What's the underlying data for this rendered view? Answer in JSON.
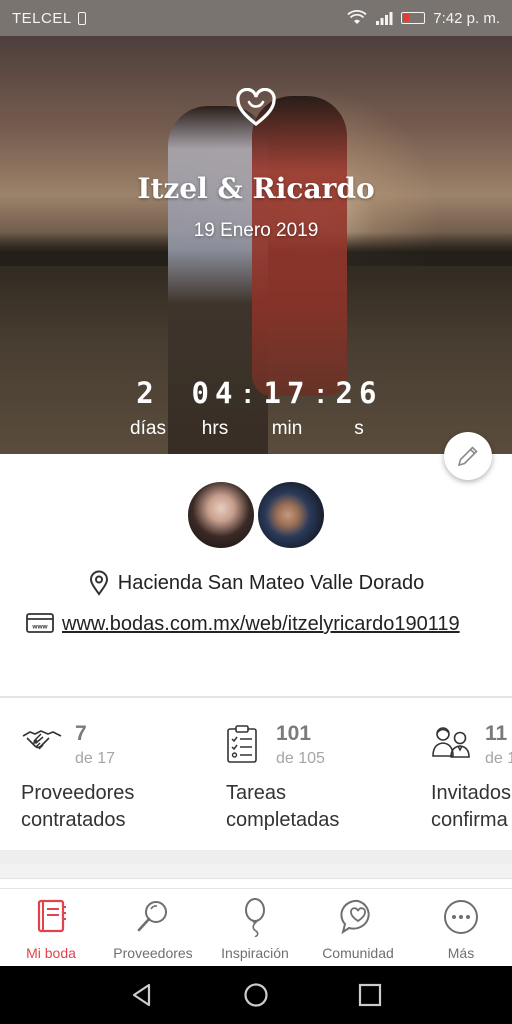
{
  "status_bar": {
    "carrier": "TELCEL",
    "time": "7:42 p. m."
  },
  "hero": {
    "couple_names": "Itzel & Ricardo",
    "date": "19 Enero 2019",
    "countdown": {
      "days": "2",
      "hours": "04",
      "minutes": "17",
      "seconds": "26",
      "days_label": "días",
      "hours_label": "hrs",
      "minutes_label": "min",
      "seconds_label": "s"
    }
  },
  "info": {
    "location": "Hacienda San Mateo Valle Dorado",
    "website": "www.bodas.com.mx/web/itzelyricardo190119"
  },
  "stats": [
    {
      "value": "7",
      "of": "de 17",
      "label_line1": "Proveedores",
      "label_line2": "contratados",
      "icon": "handshake-icon"
    },
    {
      "value": "101",
      "of": "de 105",
      "label_line1": "Tareas",
      "label_line2": "completadas",
      "icon": "checklist-icon"
    },
    {
      "value": "11",
      "of": "de 1",
      "label_line1": "Invitados",
      "label_line2": "confirma",
      "icon": "guests-icon"
    }
  ],
  "bottom_nav": {
    "items": [
      {
        "label": "Mi boda",
        "icon": "planner-book-icon",
        "active": true
      },
      {
        "label": "Proveedores",
        "icon": "search-icon",
        "active": false
      },
      {
        "label": "Inspiración",
        "icon": "balloon-icon",
        "active": false
      },
      {
        "label": "Comunidad",
        "icon": "chat-heart-icon",
        "active": false
      },
      {
        "label": "Más",
        "icon": "more-icon",
        "active": false
      }
    ]
  },
  "colors": {
    "accent": "#e0444a",
    "text_dark": "#222222",
    "muted": "#7a7a7a"
  }
}
